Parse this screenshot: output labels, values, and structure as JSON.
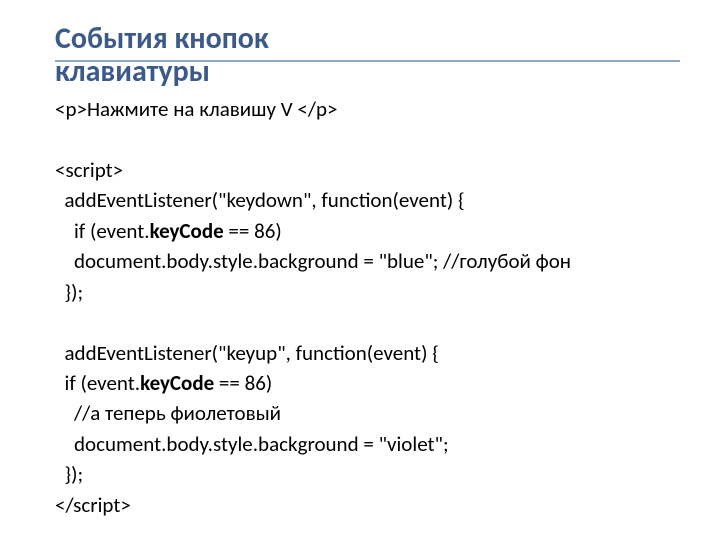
{
  "title": {
    "line1": "События кнопок",
    "line2": "клавиатуры"
  },
  "code": {
    "l1a": "<p>",
    "l1b": "Нажмите на клавишу V ",
    "l1c": "</p>",
    "l3": "<script>",
    "l4": "  addEventListener(\"keydown\", function(event) {",
    "l5a": "    if (event.",
    "l5b": "keyCode",
    "l5c": " == 86)",
    "l6": "    document.body.style.background = \"blue\"; //голубой фон",
    "l7": "  });",
    "l9": "  addEventListener(\"keyup\", function(event) {",
    "l10a": "  if (event.",
    "l10b": "keyCode",
    "l10c": " == 86)",
    "l11": "    //а теперь фиолетовый",
    "l12": "    document.body.style.background = \"violet\";",
    "l13": "  });",
    "l14": "</script>"
  }
}
